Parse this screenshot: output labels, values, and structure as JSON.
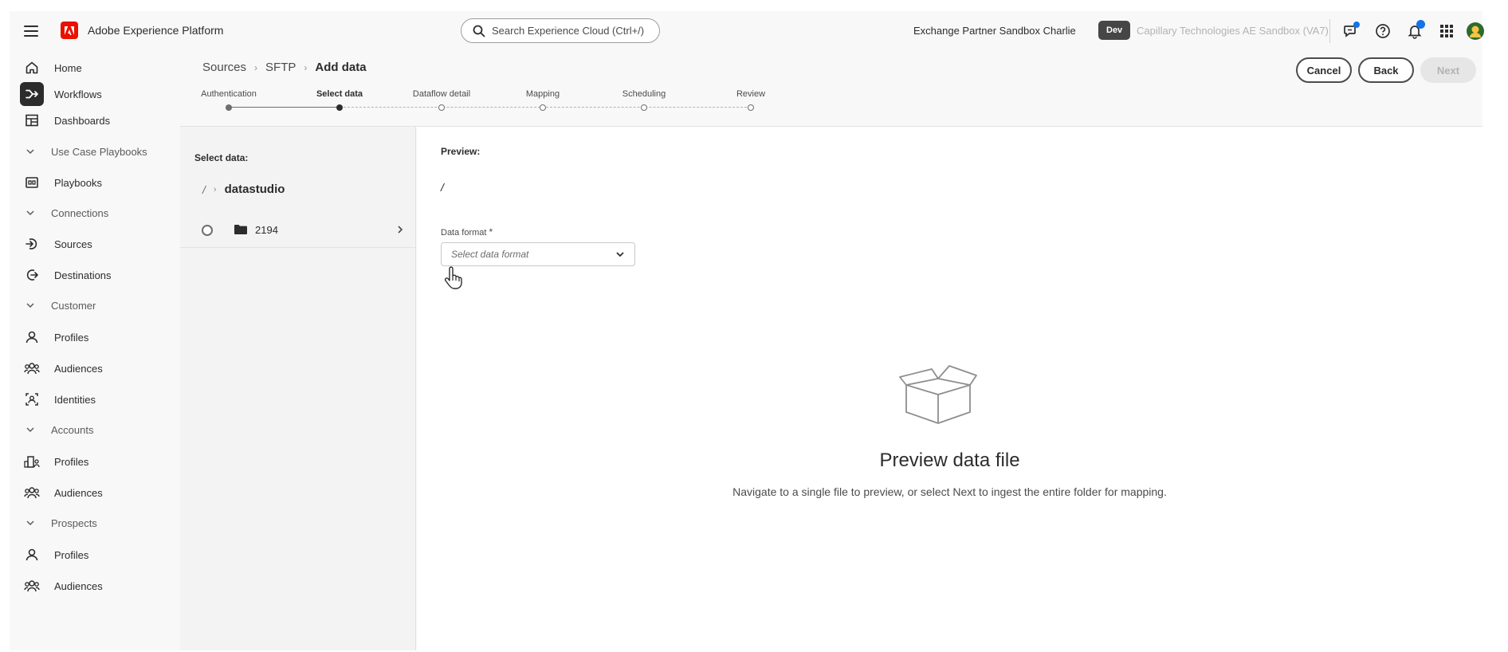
{
  "header": {
    "app_name": "Adobe Experience Platform",
    "search_placeholder": "Search Experience Cloud (Ctrl+/)",
    "org_name": "Exchange Partner Sandbox Charlie",
    "env_badge": "Dev",
    "sandbox_name": "Capillary Technologies AE Sandbox (VA7)",
    "icons": [
      "feedback-icon",
      "help-icon",
      "notifications-icon",
      "apps-grid-icon",
      "user-avatar"
    ]
  },
  "sidebar": {
    "items": [
      {
        "label": "Home",
        "icon": "home-icon"
      },
      {
        "label": "Workflows",
        "icon": "workflows-icon",
        "active": true
      },
      {
        "label": "Dashboards",
        "icon": "dashboards-icon"
      },
      {
        "label": "Use Case Playbooks",
        "section": true
      },
      {
        "label": "Playbooks",
        "icon": "playbooks-icon"
      },
      {
        "label": "Connections",
        "section": true
      },
      {
        "label": "Sources",
        "icon": "sources-icon"
      },
      {
        "label": "Destinations",
        "icon": "destinations-icon"
      },
      {
        "label": "Customer",
        "section": true
      },
      {
        "label": "Profiles",
        "icon": "profile-icon"
      },
      {
        "label": "Audiences",
        "icon": "audiences-icon"
      },
      {
        "label": "Identities",
        "icon": "identities-icon"
      },
      {
        "label": "Accounts",
        "section": true
      },
      {
        "label": "Profiles",
        "icon": "account-profiles-icon"
      },
      {
        "label": "Audiences",
        "icon": "audiences-icon"
      },
      {
        "label": "Prospects",
        "section": true
      },
      {
        "label": "Profiles",
        "icon": "profile-icon"
      },
      {
        "label": "Audiences",
        "icon": "audiences-icon"
      }
    ]
  },
  "breadcrumb": {
    "items": [
      "Sources",
      "SFTP"
    ],
    "current": "Add data",
    "separator": "›"
  },
  "actions": {
    "cancel": "Cancel",
    "back": "Back",
    "next": "Next"
  },
  "stepper": {
    "steps": [
      {
        "label": "Authentication",
        "state": "done"
      },
      {
        "label": "Select data",
        "state": "current"
      },
      {
        "label": "Dataflow detail",
        "state": "pending"
      },
      {
        "label": "Mapping",
        "state": "pending"
      },
      {
        "label": "Scheduling",
        "state": "pending"
      },
      {
        "label": "Review",
        "state": "pending"
      }
    ]
  },
  "select_data": {
    "title": "Select data:",
    "path_root": "/",
    "path_folder": "datastudio",
    "rows": [
      {
        "name": "2194",
        "type": "folder"
      }
    ]
  },
  "preview": {
    "title": "Preview:",
    "path": "/",
    "data_format_label": "Data format",
    "required_marker": "*",
    "data_format_placeholder": "Select data format",
    "empty_title": "Preview data file",
    "empty_desc": "Navigate to a single file to preview, or select Next to ingest the entire folder for mapping."
  },
  "colors": {
    "adobe_red": "#eb1000",
    "accent_blue": "#1473e6",
    "text_dark": "#2c2c2c",
    "sidebar_bg": "#f8f8f8"
  }
}
